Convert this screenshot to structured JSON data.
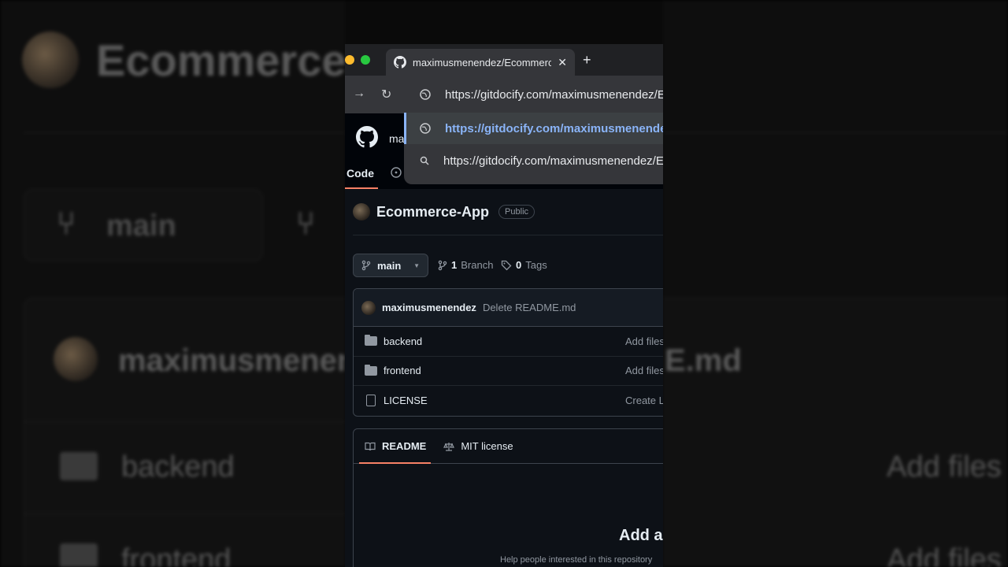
{
  "background": {
    "title": "Ecommerce",
    "branch": "main",
    "commit_user": "maximusmenendez",
    "commit_suffix": "E.md",
    "rows": [
      "backend",
      "frontend"
    ],
    "row_action": "Add files"
  },
  "browser": {
    "tab_title": "maximusmenendez/Ecommerce-App",
    "new_tab": "+",
    "close": "✕"
  },
  "omnibox": {
    "suggestions": [
      {
        "icon": "globe-icon",
        "text": "https://gitdocify.com/maximusmenendez/Ecommerce-App"
      },
      {
        "icon": "globe-icon",
        "text": "https://gitdocify.com/maximusmenendez/Ecommerce-App",
        "selected": true
      },
      {
        "icon": "search-icon",
        "text": "https://gitdocify.com/maximusmenendez/Ecommerce-App"
      }
    ]
  },
  "github": {
    "user_short": "ma",
    "tab_code": "Code",
    "repo_name": "Ecommerce-App",
    "visibility": "Public",
    "branch": "main",
    "branch_count": "1",
    "branch_label": "Branch",
    "tag_count": "0",
    "tag_label": "Tags",
    "latest_commit": {
      "user": "maximusmenendez",
      "message": "Delete README.md"
    },
    "files": [
      {
        "type": "folder",
        "name": "backend",
        "commit": "Add files"
      },
      {
        "type": "folder",
        "name": "frontend",
        "commit": "Add files"
      },
      {
        "type": "file",
        "name": "LICENSE",
        "commit": "Create L"
      }
    ],
    "readme_tabs": {
      "readme": "README",
      "license": "MIT license"
    },
    "readme_heading": "Add a",
    "readme_sub": "Help people interested in this repository"
  },
  "colors": {
    "accent": "#f78166",
    "link": "#8ab4f8",
    "bg": "#0d1117"
  }
}
